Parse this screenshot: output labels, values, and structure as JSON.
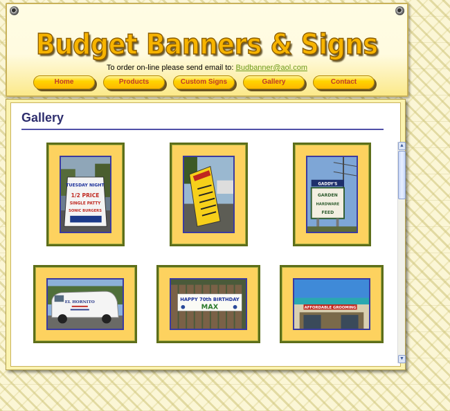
{
  "header": {
    "title": "Budget Banners & Signs",
    "order_prefix": "To order on-line please send email to:",
    "order_email": "Budbanner@aol.com"
  },
  "nav": {
    "items": [
      {
        "label": "Home"
      },
      {
        "label": "Products"
      },
      {
        "label": "Custom Signs"
      },
      {
        "label": "Gallery"
      },
      {
        "label": "Contact"
      }
    ]
  },
  "gallery": {
    "heading": "Gallery",
    "photo_texts": {
      "tuesday": "TUESDAY NIGHT",
      "half": "1/2 PRICE",
      "single": "SINGLE PATTY",
      "sonic": "SONIC BURGERS",
      "gaddys": "GADDY'S",
      "garden": "GARDEN",
      "hardware": "HARDWARE",
      "feed": "FEED",
      "happy": "HAPPY 70th BIRTHDAY",
      "max": "MAX",
      "elhornito": "EL HORNITO",
      "affordable": "AFFORDABLE GROOMING"
    }
  },
  "colors": {
    "accent": "#2e2e6e",
    "link": "#6c9a1a",
    "frame": "#fdd25f",
    "nav_text": "#c0392b"
  }
}
